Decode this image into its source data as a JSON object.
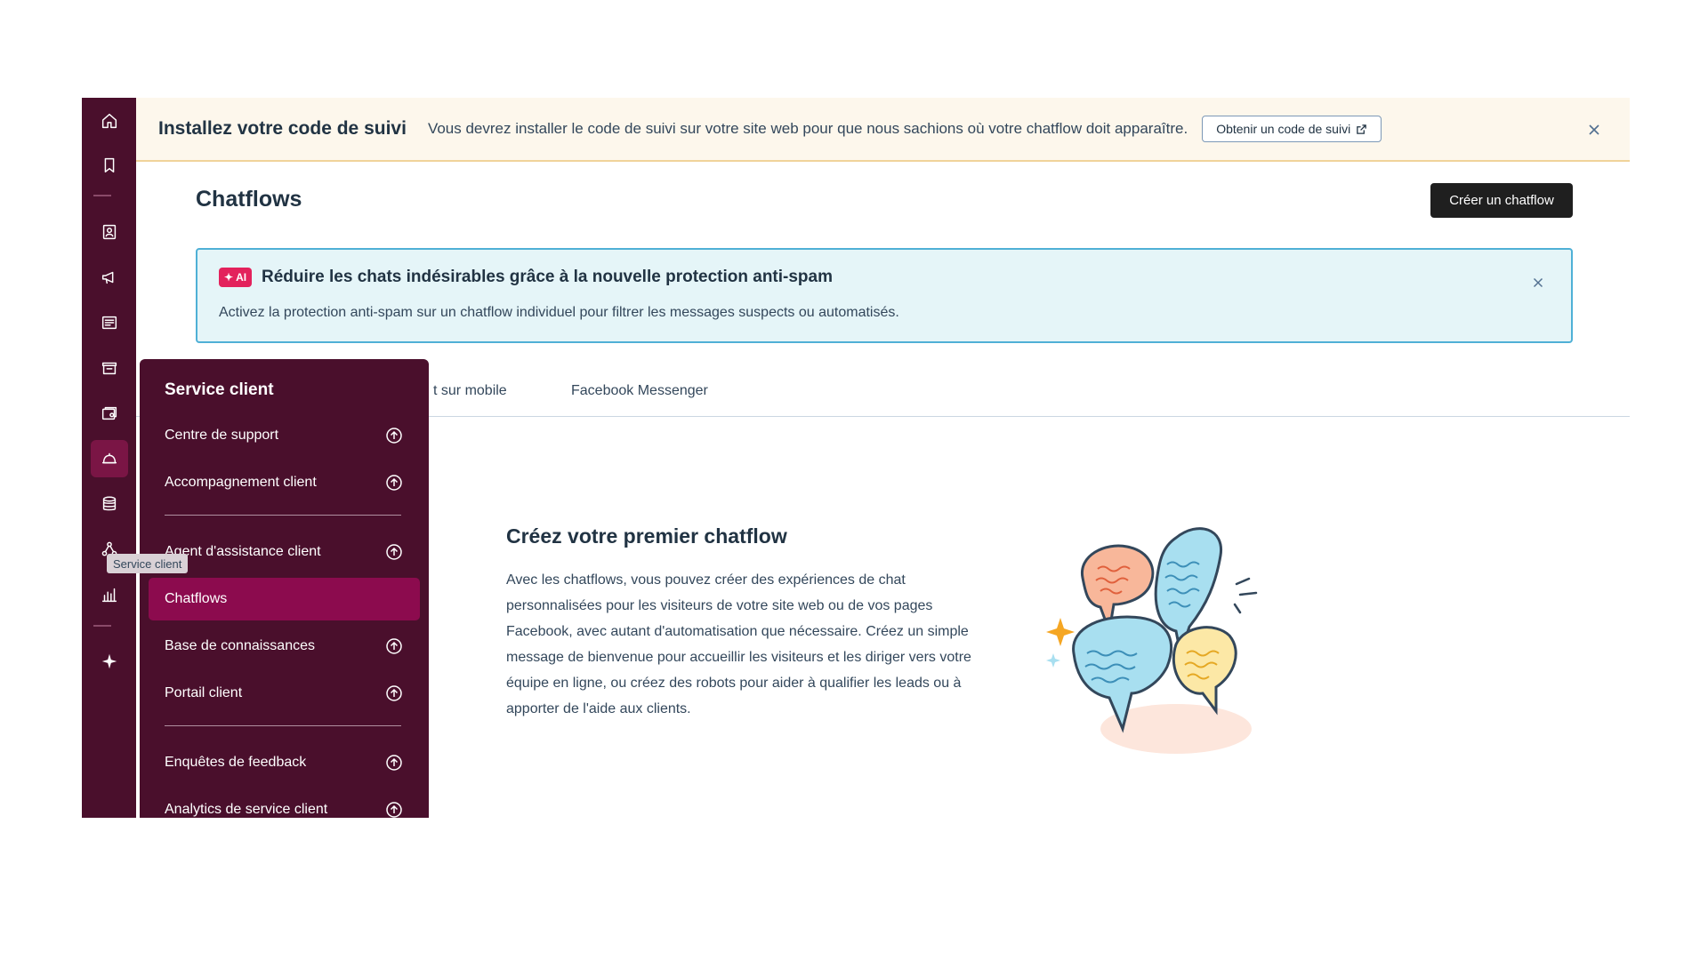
{
  "banner": {
    "title": "Installez votre code de suivi",
    "text": "Vous devrez installer le code de suivi sur votre site web pour que nous sachions où votre chatflow doit apparaître.",
    "button_label": "Obtenir un code de suivi"
  },
  "header": {
    "title": "Chatflows",
    "create_label": "Créer un chatflow"
  },
  "callout": {
    "badge": "AI",
    "title": "Réduire les chats indésirables grâce à la nouvelle protection anti-spam",
    "text": "Activez la protection anti-spam sur un chatflow individuel pour filtrer les messages suspects ou automatisés."
  },
  "tabs": [
    {
      "label": "t sur mobile"
    },
    {
      "label": "Facebook Messenger"
    }
  ],
  "empty_state": {
    "title": "Créez votre premier chatflow",
    "text": "Avec les chatflows, vous pouvez créer des expériences de chat personnalisées pour les visiteurs de votre site web ou de vos pages Facebook, avec autant d'automatisation que nécessaire. Créez un simple message de bienvenue pour accueillir les visiteurs et les diriger vers votre équipe en ligne, ou créez des robots pour aider à qualifier les leads ou à apporter de l'aide aux clients."
  },
  "menu": {
    "title": "Service client",
    "items": [
      {
        "label": "Centre de support",
        "has_arrow": true
      },
      {
        "label": "Accompagnement client",
        "has_arrow": true
      },
      {
        "label": "Agent d'assistance client",
        "has_arrow": true
      },
      {
        "label": "Chatflows",
        "active": true
      },
      {
        "label": "Base de connaissances",
        "has_arrow": true
      },
      {
        "label": "Portail client",
        "has_arrow": true
      },
      {
        "label": "Enquêtes de feedback",
        "has_arrow": true
      },
      {
        "label": "Analytics de service client",
        "has_arrow": true
      }
    ]
  },
  "tooltip": "Service client",
  "rail": {
    "icons": [
      "home-icon",
      "bookmark-icon",
      "contacts-icon",
      "marketing-icon",
      "content-icon",
      "commerce-icon",
      "sales-icon",
      "service-icon",
      "data-icon",
      "automation-icon",
      "reporting-icon",
      "ai-sparkle-icon"
    ],
    "active": "service-icon"
  },
  "colors": {
    "rail": "#4a0f2c",
    "menu_active": "#8c0b4e",
    "banner_bg": "#fdf7ec",
    "callout_bg": "#e5f5f8",
    "callout_border": "#4fb0d6",
    "ai_badge": "#e3225c",
    "primary_button": "#1f1f1f"
  }
}
